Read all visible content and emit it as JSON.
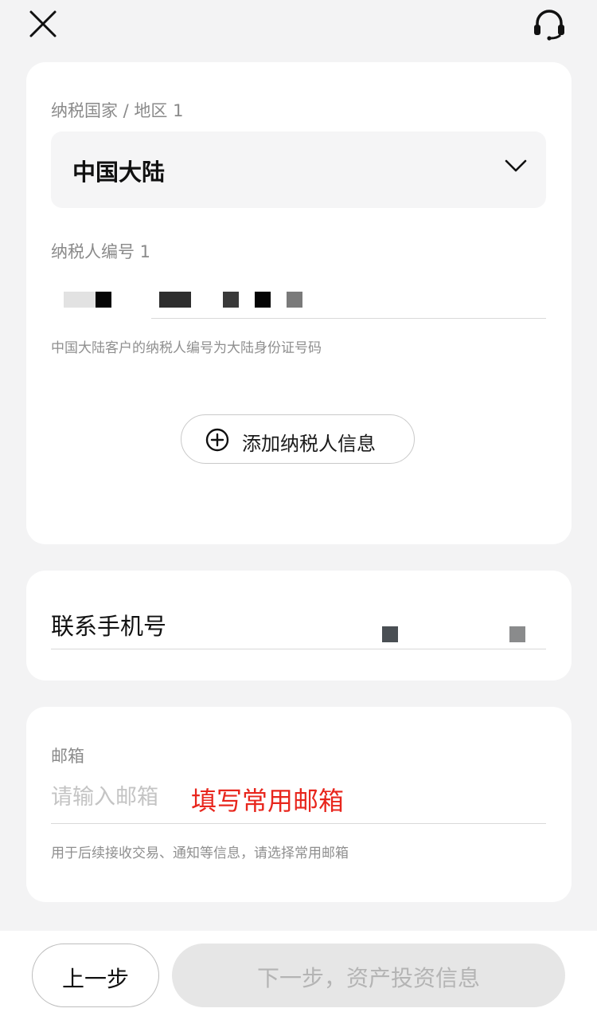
{
  "header": {
    "close_icon": "close-icon",
    "support_icon": "headset-icon"
  },
  "tax_section": {
    "country_label": "纳税国家 / 地区 1",
    "country_value": "中国大陆",
    "dropdown_icon": "chevron-down-icon",
    "taxpayer_id_label": "纳税人编号 1",
    "taxpayer_id_hint": "中国大陆客户的纳税人编号为大陆身份证号码",
    "add_button_label": "添加纳税人信息",
    "add_icon": "plus-circle-icon"
  },
  "phone_section": {
    "label": "联系手机号"
  },
  "email_section": {
    "label": "邮箱",
    "placeholder": "请输入邮箱",
    "annotation": "填写常用邮箱",
    "hint": "用于后续接收交易、通知等信息，请选择常用邮箱"
  },
  "footer": {
    "prev_label": "上一步",
    "next_label": "下一步，资产投资信息"
  },
  "colors": {
    "annotation_red": "#e8261d",
    "disabled_button_bg": "#e6e6e6"
  }
}
